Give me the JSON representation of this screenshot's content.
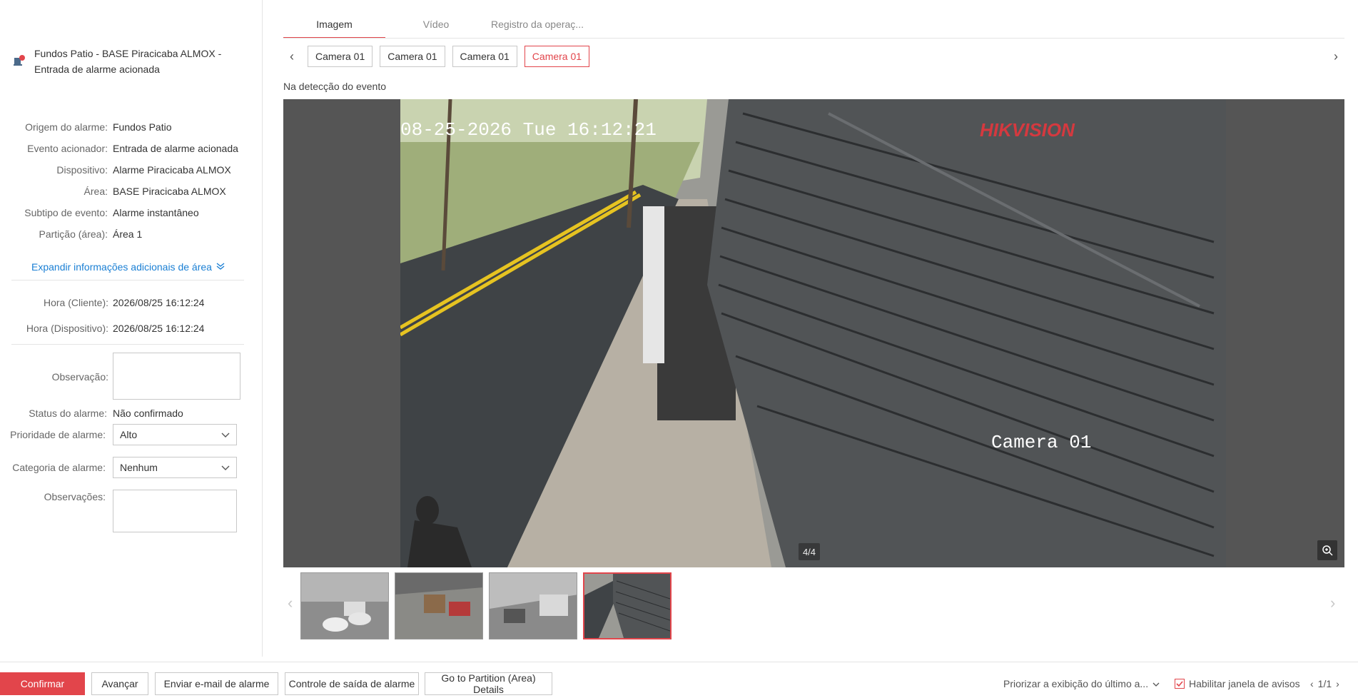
{
  "alarm": {
    "title_line1": "Fundos Patio - BASE Piracicaba ALMOX -",
    "title_line2": "Entrada de alarme acionada",
    "icon": "alarm-bell-icon"
  },
  "info": [
    {
      "label": "Origem do alarme:",
      "value": "Fundos Patio"
    },
    {
      "label": "Evento acionador:",
      "value": "Entrada de alarme acionada"
    },
    {
      "label": "Dispositivo:",
      "value": "Alarme Piracicaba ALMOX"
    },
    {
      "label": "Área:",
      "value": "BASE Piracicaba ALMOX"
    },
    {
      "label": "Subtipo de evento:",
      "value": "Alarme instantâneo"
    },
    {
      "label": "Partição (área):",
      "value": "Área 1"
    }
  ],
  "expand_link": "Expandir informações adicionais de área",
  "times": [
    {
      "label": "Hora (Cliente):",
      "value": "2026/08/25 16:12:24"
    },
    {
      "label": "Hora (Dispositivo):",
      "value": "2026/08/25 16:12:24"
    }
  ],
  "form": {
    "observacao_label": "Observação:",
    "status_label": "Status do alarme:",
    "status_value": "Não confirmado",
    "priority_label": "Prioridade de alarme:",
    "priority_value": "Alto",
    "category_label": "Categoria de alarme:",
    "category_value": "Nenhum",
    "observacoes_label": "Observações:"
  },
  "tabs": [
    "Imagem",
    "Vídeo",
    "Registro da operaç..."
  ],
  "cameras": [
    "Camera 01",
    "Camera 01",
    "Camera 01",
    "Camera 01"
  ],
  "event_caption": "Na detecção do evento",
  "viewer": {
    "osd_timestamp": "08-25-2026 Tue 16:12:21",
    "osd_brand": "HIKVISION",
    "osd_camera": "Camera 01",
    "counter": "4/4"
  },
  "bottom": {
    "confirm": "Confirmar",
    "advance": "Avançar",
    "email": "Enviar e-mail de alarme",
    "output": "Controle de saída de alarme",
    "partition": "Go to Partition (Area) Details",
    "prioritize": "Priorizar a exibição do último a...",
    "enable_popup": "Habilitar janela de avisos",
    "page": "1/1"
  },
  "colors": {
    "accent": "#e2454b",
    "link": "#1a7fd4"
  }
}
